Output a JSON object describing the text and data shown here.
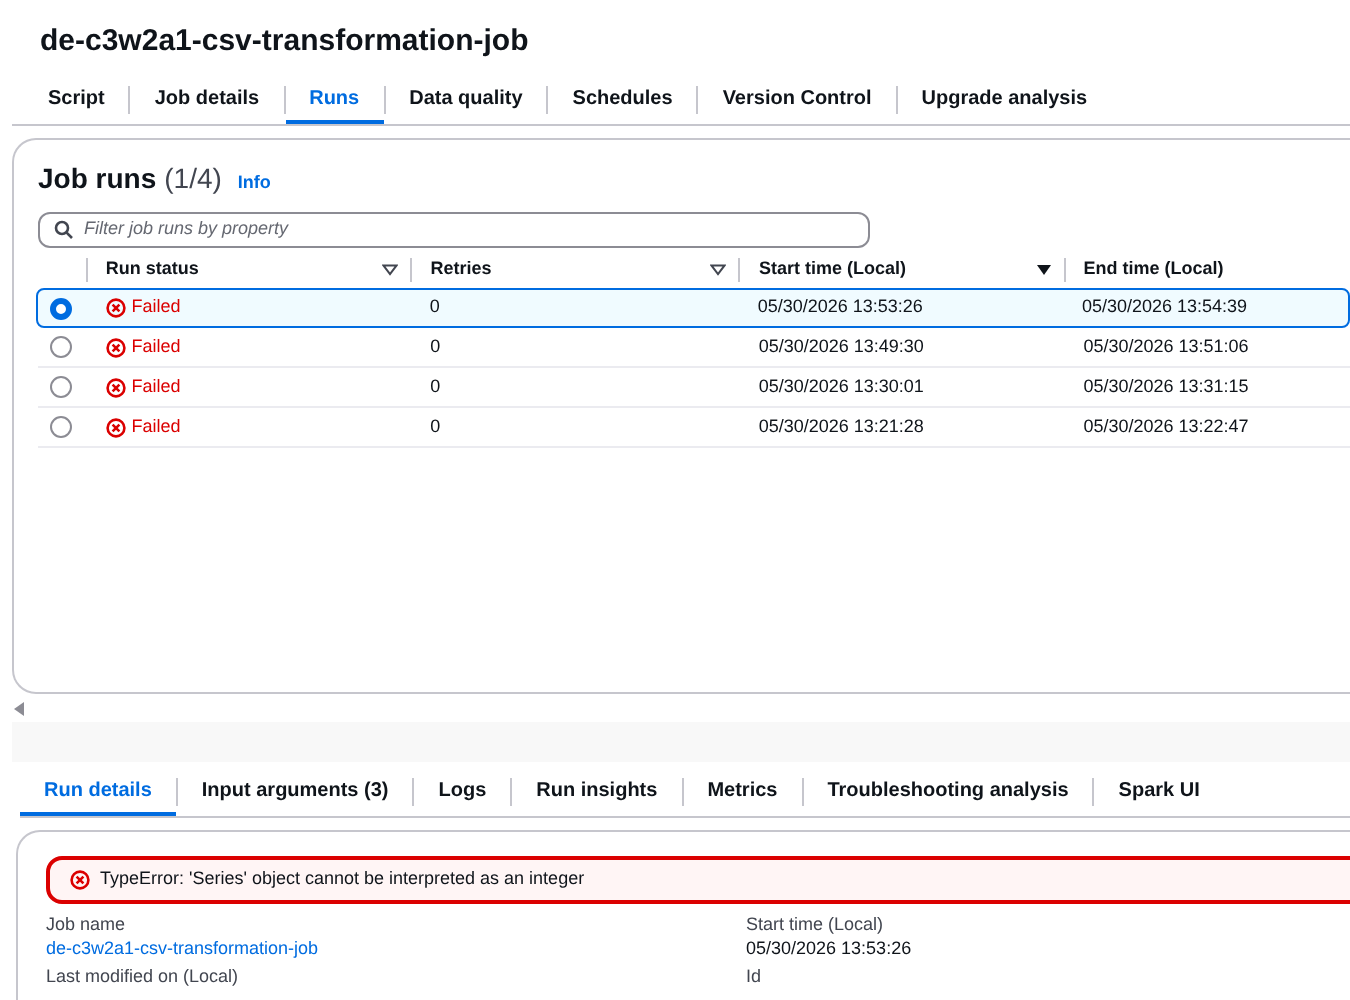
{
  "page_title": "de-c3w2a1-csv-transformation-job",
  "tabs": [
    {
      "label": "Script",
      "selected": false
    },
    {
      "label": "Job details",
      "selected": false
    },
    {
      "label": "Runs",
      "selected": true
    },
    {
      "label": "Data quality",
      "selected": false
    },
    {
      "label": "Schedules",
      "selected": false
    },
    {
      "label": "Version Control",
      "selected": false
    },
    {
      "label": "Upgrade analysis",
      "selected": false
    }
  ],
  "job_runs": {
    "title": "Job runs",
    "count": "(1/4)",
    "info": "Info",
    "search": {
      "placeholder": "Filter job runs by property"
    },
    "columns": [
      {
        "label": "Run status",
        "sorted": false
      },
      {
        "label": "Retries",
        "sorted": false
      },
      {
        "label": "Start time (Local)",
        "sorted": true
      },
      {
        "label": "End time (Local)"
      }
    ],
    "rows": [
      {
        "selected": true,
        "status": "Failed",
        "retries": "0",
        "start": "05/30/2026 13:53:26",
        "end": "05/30/2026 13:54:39"
      },
      {
        "selected": false,
        "status": "Failed",
        "retries": "0",
        "start": "05/30/2026 13:49:30",
        "end": "05/30/2026 13:51:06"
      },
      {
        "selected": false,
        "status": "Failed",
        "retries": "0",
        "start": "05/30/2026 13:30:01",
        "end": "05/30/2026 13:31:15"
      },
      {
        "selected": false,
        "status": "Failed",
        "retries": "0",
        "start": "05/30/2026 13:21:28",
        "end": "05/30/2026 13:22:47"
      }
    ]
  },
  "detail_tabs": [
    {
      "label": "Run details",
      "selected": true
    },
    {
      "label": "Input arguments (3)",
      "selected": false
    },
    {
      "label": "Logs",
      "selected": false
    },
    {
      "label": "Run insights",
      "selected": false
    },
    {
      "label": "Metrics",
      "selected": false
    },
    {
      "label": "Troubleshooting analysis",
      "selected": false
    },
    {
      "label": "Spark UI",
      "selected": false
    }
  ],
  "error": "TypeError: 'Series' object cannot be interpreted as an integer",
  "fields": [
    {
      "label": "Job name",
      "value": "de-c3w2a1-csv-transformation-job",
      "kind": "link"
    },
    {
      "label": "Start time (Local)",
      "value": "05/30/2026 13:53:26",
      "kind": "text"
    },
    {
      "label": "Last modified on (Local)"
    },
    {
      "label": "Id"
    }
  ]
}
